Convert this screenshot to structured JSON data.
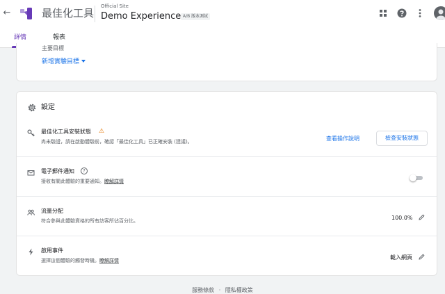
{
  "header": {
    "back_glyph": "←",
    "product_name": "最佳化工具",
    "site_label": "Official Site",
    "experience_name": "Demo Experience",
    "experience_type": "A/B 版本測試",
    "icons": [
      "back-arrow-icon",
      "optimize-logo-icon",
      "apps-grid-icon",
      "help-icon",
      "more-vert-icon",
      "avatar"
    ]
  },
  "tabs": [
    {
      "label": "詳情",
      "active": true
    },
    {
      "label": "報表",
      "active": false
    }
  ],
  "objectives": {
    "cut_label": "主要目標",
    "add_goal_label": "新增實驗目標"
  },
  "settings": {
    "title": "設定",
    "install": {
      "title": "最佳化工具安裝狀態",
      "warning_glyph": "⚠",
      "desc": "尚未驗證，請在啟動體驗前，確認「最佳化工具」已正確安裝 (建議)。",
      "guide_label": "查看操作說明",
      "check_label": "檢查安裝狀態"
    },
    "email": {
      "title": "電子郵件通知",
      "help_glyph": "?",
      "desc": "接收有關此體驗的重要通知。",
      "learn_more": "瞭解詳情",
      "enabled": false
    },
    "traffic": {
      "title": "流量分配",
      "desc": "符合參與此體驗資格的所有訪客所佔百分比。",
      "value": "100.0%"
    },
    "activation": {
      "title": "啟用事件",
      "desc": "選擇這個體驗的觸發時機。",
      "learn_more": "瞭解詳情",
      "value": "載入網頁"
    }
  },
  "footer": {
    "terms": "服務條款",
    "separator": "·",
    "privacy": "隱私權政策"
  },
  "colors": {
    "accent": "#673ab7",
    "link": "#1a73e8",
    "warning": "#e37400",
    "background": "#f1f3f4"
  }
}
